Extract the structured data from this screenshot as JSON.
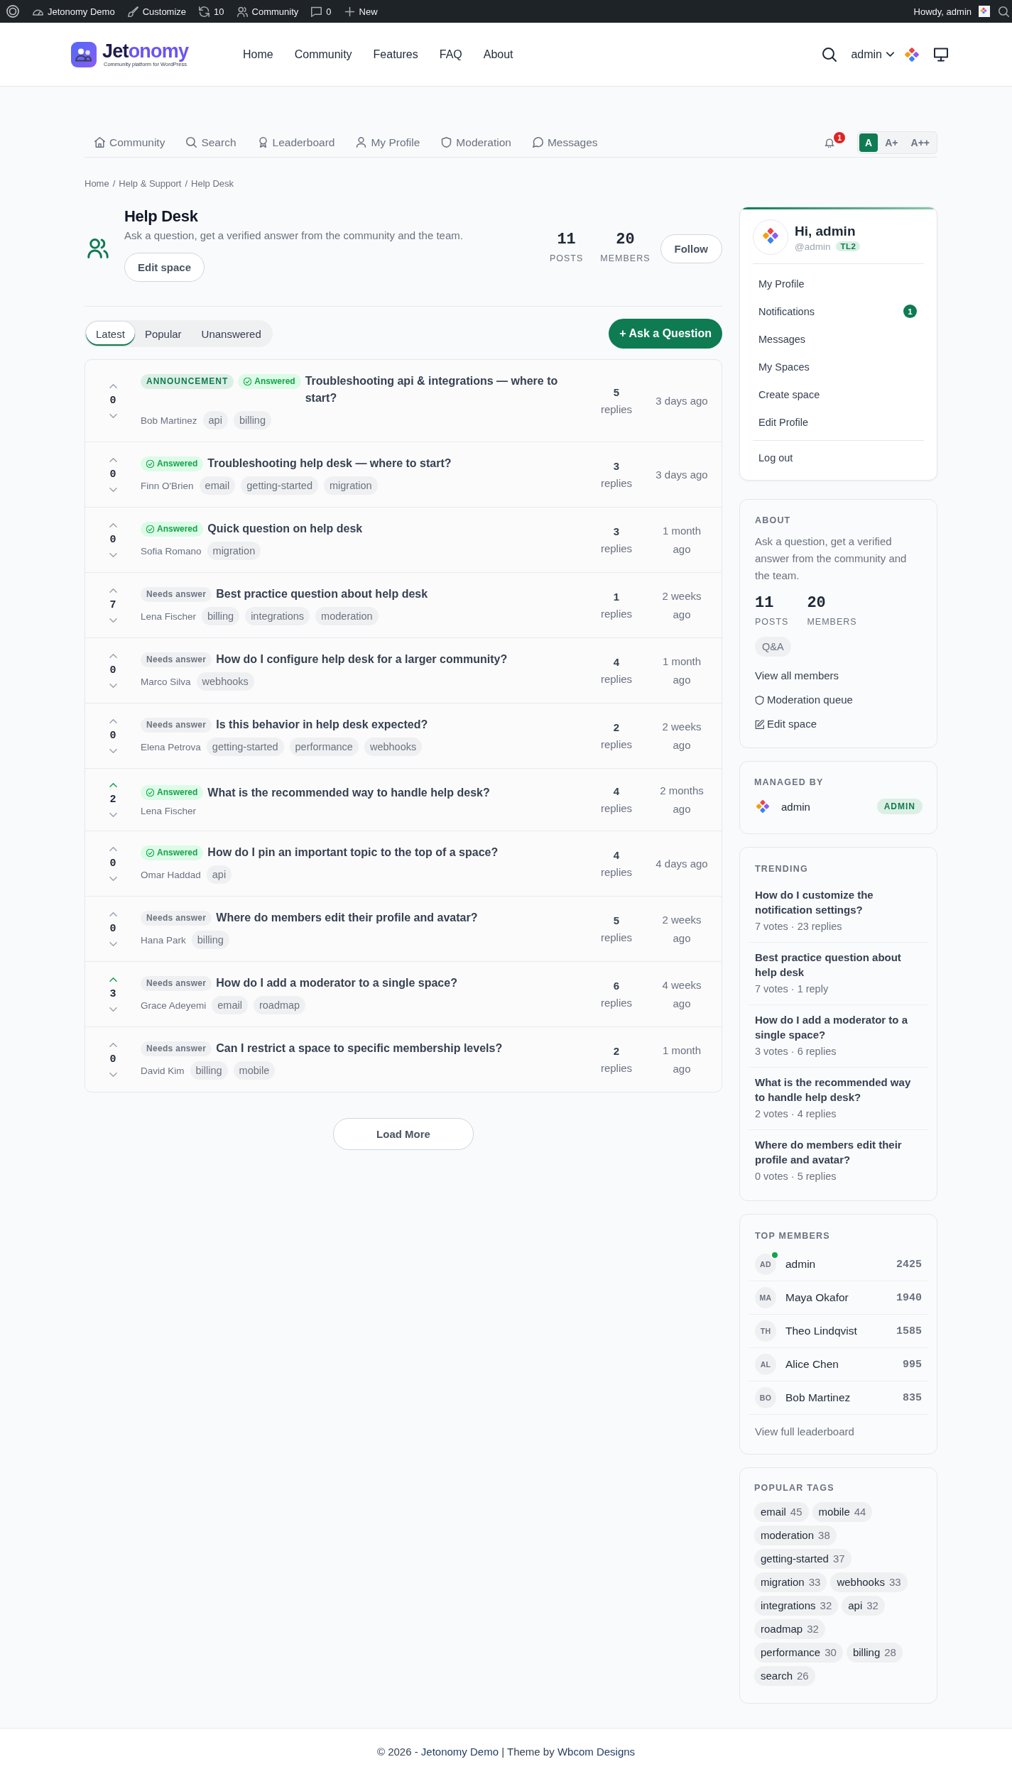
{
  "admin_bar": {
    "items": [
      {
        "kind": "site",
        "label": "Jetonomy Demo"
      },
      {
        "kind": "customize",
        "label": "Customize"
      },
      {
        "kind": "updates",
        "label": "10"
      },
      {
        "kind": "community",
        "label": "Community"
      },
      {
        "kind": "comments",
        "label": "0"
      },
      {
        "kind": "new",
        "label": "New"
      }
    ],
    "greeting": "Howdy, admin"
  },
  "header": {
    "logo": {
      "wordmark": {
        "plain": "Jet",
        "accent": "onomy"
      },
      "tagline": "Community platform for WordPress"
    },
    "nav": [
      "Home",
      "Community",
      "Features",
      "FAQ",
      "About"
    ],
    "user": "admin"
  },
  "community_nav": {
    "items": [
      {
        "kind": "home",
        "label": "Community"
      },
      {
        "kind": "search",
        "label": "Search"
      },
      {
        "kind": "leaderboard",
        "label": "Leaderboard"
      },
      {
        "kind": "profile",
        "label": "My Profile"
      },
      {
        "kind": "moderation",
        "label": "Moderation"
      },
      {
        "kind": "messages",
        "label": "Messages"
      }
    ],
    "notification_count": "1",
    "font_sizes": [
      {
        "label": "A",
        "selected": true
      },
      {
        "label": "A+",
        "selected": false
      },
      {
        "label": "A++",
        "selected": false
      }
    ]
  },
  "breadcrumb": [
    {
      "label": "Home",
      "separator": "/"
    },
    {
      "label": "Help & Support",
      "separator": "/"
    },
    {
      "label": "Help Desk"
    }
  ],
  "space": {
    "title": "Help Desk",
    "description": "Ask a question, get a verified answer from the community and the team.",
    "edit_button": "Edit space",
    "stats": [
      {
        "value": "11",
        "label": "POSTS"
      },
      {
        "value": "20",
        "label": "MEMBERS"
      }
    ],
    "follow_button": "Follow"
  },
  "tabs": [
    {
      "label": "Latest",
      "selected": true
    },
    {
      "label": "Popular",
      "selected": false
    },
    {
      "label": "Unanswered",
      "selected": false
    }
  ],
  "ask_button": "+ Ask a Question",
  "posts": [
    {
      "votes": "0",
      "upvoted": false,
      "badges": [
        {
          "kind": "announcement",
          "label": "ANNOUNCEMENT"
        },
        {
          "kind": "answered",
          "label": "Answered"
        }
      ],
      "title": "Troubleshooting api & integrations — where to start?",
      "author": "Bob Martinez",
      "tags": [
        "api",
        "billing"
      ],
      "replies": "5",
      "replies_label": "replies",
      "time": "3 days ago"
    },
    {
      "votes": "0",
      "upvoted": false,
      "badges": [
        {
          "kind": "answered",
          "label": "Answered"
        }
      ],
      "title": "Troubleshooting help desk — where to start?",
      "author": "Finn O'Brien",
      "tags": [
        "email",
        "getting-started",
        "migration"
      ],
      "replies": "3",
      "replies_label": "replies",
      "time": "3 days ago"
    },
    {
      "votes": "0",
      "upvoted": false,
      "badges": [
        {
          "kind": "answered",
          "label": "Answered"
        }
      ],
      "title": "Quick question on help desk",
      "author": "Sofia Romano",
      "tags": [
        "migration"
      ],
      "replies": "3",
      "replies_label": "replies",
      "time": "1 month ago"
    },
    {
      "votes": "7",
      "upvoted": false,
      "badges": [
        {
          "kind": "needs_answer",
          "label": "Needs answer"
        }
      ],
      "title": "Best practice question about help desk",
      "author": "Lena Fischer",
      "tags": [
        "billing",
        "integrations",
        "moderation"
      ],
      "replies": "1",
      "replies_label": "replies",
      "time": "2 weeks ago"
    },
    {
      "votes": "0",
      "upvoted": false,
      "badges": [
        {
          "kind": "needs_answer",
          "label": "Needs answer"
        }
      ],
      "title": "How do I configure help desk for a larger community?",
      "author": "Marco Silva",
      "tags": [
        "webhooks"
      ],
      "replies": "4",
      "replies_label": "replies",
      "time": "1 month ago"
    },
    {
      "votes": "0",
      "upvoted": false,
      "badges": [
        {
          "kind": "needs_answer",
          "label": "Needs answer"
        }
      ],
      "title": "Is this behavior in help desk expected?",
      "author": "Elena Petrova",
      "tags": [
        "getting-started",
        "performance",
        "webhooks"
      ],
      "replies": "2",
      "replies_label": "replies",
      "time": "2 weeks ago"
    },
    {
      "votes": "2",
      "upvoted": true,
      "badges": [
        {
          "kind": "answered",
          "label": "Answered"
        }
      ],
      "title": "What is the recommended way to handle help desk?",
      "author": "Lena Fischer",
      "replies": "4",
      "replies_label": "replies",
      "time": "2 months ago"
    },
    {
      "votes": "0",
      "upvoted": false,
      "badges": [
        {
          "kind": "answered",
          "label": "Answered"
        }
      ],
      "title": "How do I pin an important topic to the top of a space?",
      "author": "Omar Haddad",
      "tags": [
        "api"
      ],
      "replies": "4",
      "replies_label": "replies",
      "time": "4 days ago"
    },
    {
      "votes": "0",
      "upvoted": false,
      "badges": [
        {
          "kind": "needs_answer",
          "label": "Needs answer"
        }
      ],
      "title": "Where do members edit their profile and avatar?",
      "author": "Hana Park",
      "tags": [
        "billing"
      ],
      "replies": "5",
      "replies_label": "replies",
      "time": "2 weeks ago"
    },
    {
      "votes": "3",
      "upvoted": true,
      "badges": [
        {
          "kind": "needs_answer",
          "label": "Needs answer"
        }
      ],
      "title": "How do I add a moderator to a single space?",
      "author": "Grace Adeyemi",
      "tags": [
        "email",
        "roadmap"
      ],
      "replies": "6",
      "replies_label": "replies",
      "time": "4 weeks ago"
    },
    {
      "votes": "0",
      "upvoted": false,
      "badges": [
        {
          "kind": "needs_answer",
          "label": "Needs answer"
        }
      ],
      "title": "Can I restrict a space to specific membership levels?",
      "author": "David Kim",
      "tags": [
        "billing",
        "mobile"
      ],
      "replies": "2",
      "replies_label": "replies",
      "time": "1 month ago"
    }
  ],
  "load_more": "Load More",
  "sidebar": {
    "user_card": {
      "greeting": "Hi, admin",
      "handle": "@admin",
      "trust_level": "TL2",
      "menu": [
        {
          "label": "My Profile"
        },
        {
          "label": "Notifications",
          "badge": "1"
        },
        {
          "label": "Messages"
        },
        {
          "label": "My Spaces"
        },
        {
          "label": "Create space"
        },
        {
          "label": "Edit Profile"
        }
      ],
      "logout": "Log out"
    },
    "about": {
      "heading": "ABOUT",
      "description": "Ask a question, get a verified answer from the community and the team.",
      "stats": [
        {
          "value": "11",
          "label": "POSTS"
        },
        {
          "value": "20",
          "label": "MEMBERS"
        }
      ],
      "chip": "Q&A",
      "links": [
        {
          "kind": "members",
          "label": "View all members"
        },
        {
          "kind": "moderation",
          "label": "Moderation queue"
        },
        {
          "kind": "edit",
          "label": "Edit space"
        }
      ]
    },
    "managed_by": {
      "heading": "MANAGED BY",
      "name": "admin",
      "role": "ADMIN"
    },
    "trending": {
      "heading": "TRENDING",
      "items": [
        {
          "title": "How do I customize the notification settings?",
          "meta": "7 votes · 23 replies"
        },
        {
          "title": "Best practice question about help desk",
          "meta": "7 votes · 1 reply"
        },
        {
          "title": "How do I add a moderator to a single space?",
          "meta": "3 votes · 6 replies"
        },
        {
          "title": "What is the recommended way to handle help desk?",
          "meta": "2 votes · 4 replies"
        },
        {
          "title": "Where do members edit their profile and avatar?",
          "meta": "0 votes · 5 replies"
        }
      ]
    },
    "top_members": {
      "heading": "TOP MEMBERS",
      "members": [
        {
          "initials": "AD",
          "name": "admin",
          "score": "2425",
          "online": true
        },
        {
          "initials": "MA",
          "name": "Maya Okafor",
          "score": "1940",
          "online": false
        },
        {
          "initials": "TH",
          "name": "Theo Lindqvist",
          "score": "1585",
          "online": false
        },
        {
          "initials": "AL",
          "name": "Alice Chen",
          "score": "995",
          "online": false
        },
        {
          "initials": "BO",
          "name": "Bob Martinez",
          "score": "835",
          "online": false
        }
      ],
      "link": "View full leaderboard"
    },
    "popular_tags": {
      "heading": "POPULAR TAGS",
      "tags": [
        {
          "name": "email",
          "count": "45"
        },
        {
          "name": "mobile",
          "count": "44"
        },
        {
          "name": "moderation",
          "count": "38"
        },
        {
          "name": "getting-started",
          "count": "37"
        },
        {
          "name": "migration",
          "count": "33"
        },
        {
          "name": "webhooks",
          "count": "33"
        },
        {
          "name": "integrations",
          "count": "32"
        },
        {
          "name": "api",
          "count": "32"
        },
        {
          "name": "roadmap",
          "count": "32"
        },
        {
          "name": "performance",
          "count": "30"
        },
        {
          "name": "billing",
          "count": "28"
        },
        {
          "name": "search",
          "count": "26"
        }
      ]
    }
  },
  "footer": {
    "prefix": "© 2026 -",
    "site_link": "Jetonomy Demo",
    "middle": "| Theme by",
    "author_link": "Wbcom Designs"
  }
}
